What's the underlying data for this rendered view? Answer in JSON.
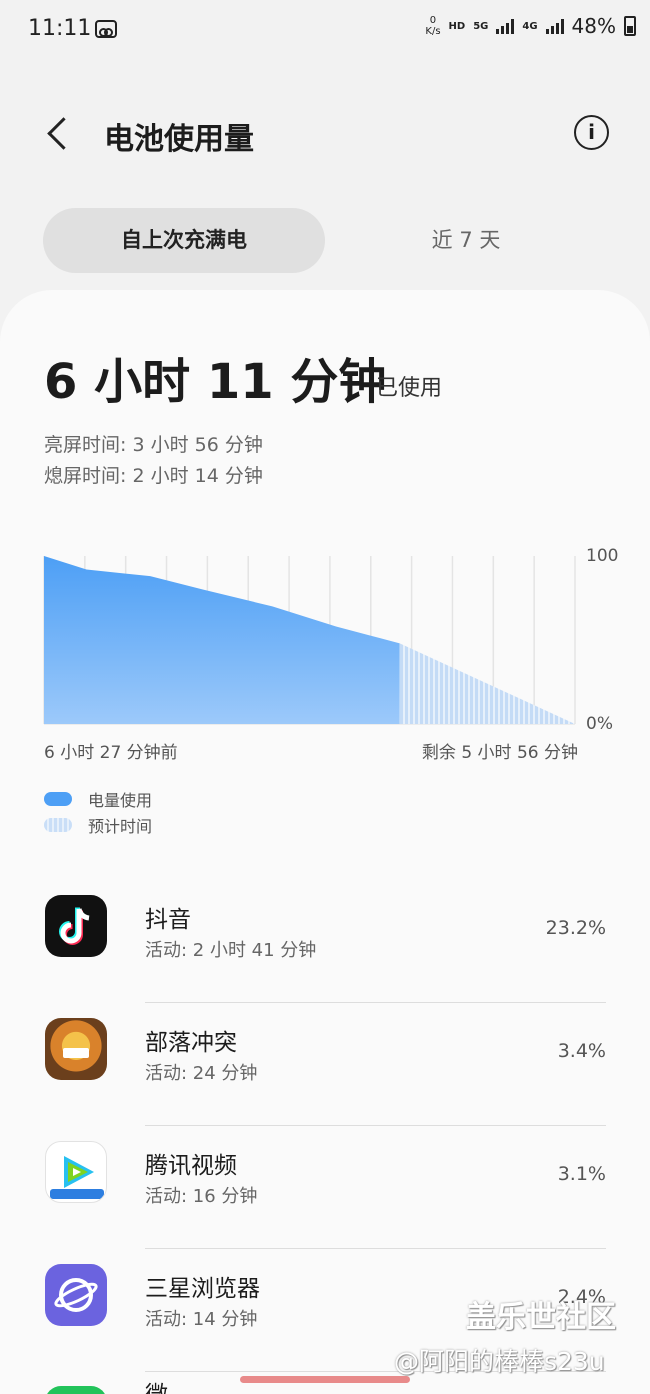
{
  "status_bar": {
    "time": "11:11",
    "net_speed_value": "0",
    "net_speed_unit": "K/s",
    "hd": "HD",
    "net1": "5G",
    "net2": "4G",
    "battery": "48%"
  },
  "header": {
    "title": "电池使用量",
    "info_symbol": "i"
  },
  "tabs": [
    {
      "label": "自上次充满电",
      "active": true
    },
    {
      "label": "近 7 天",
      "active": false
    }
  ],
  "summary": {
    "total": "6 小时 11 分钟",
    "total_suffix": "已使用",
    "screen_on": "亮屏时间: 3 小时 56 分钟",
    "screen_off": "熄屏时间:  2 小时 14 分钟"
  },
  "chart_data": {
    "type": "area",
    "ylim": [
      0,
      100
    ],
    "y_tick_labels": [
      "100",
      "0%"
    ],
    "x_start_label": "6 小时 27 分钟前",
    "x_end_label": "剩余 5 小时 56 分钟",
    "series": [
      {
        "name": "电量使用",
        "x": [
          0,
          0.08,
          0.2,
          0.3,
          0.43,
          0.55,
          0.67
        ],
        "values": [
          100,
          92,
          88,
          80,
          70,
          58,
          48
        ]
      },
      {
        "name": "预计时间",
        "x": [
          0.67,
          1.0
        ],
        "values": [
          48,
          0
        ]
      }
    ],
    "legend": [
      "电量使用",
      "预计时间"
    ],
    "grid": true,
    "colors": {
      "used": "#4d9ff5",
      "projected": "#c9def7"
    }
  },
  "apps": [
    {
      "name": "抖音",
      "active": "活动: 2 小时 41 分钟",
      "percent": "23.2%",
      "icon": "tiktok-icon"
    },
    {
      "name": "部落冲突",
      "active": "活动: 24 分钟",
      "percent": "3.4%",
      "icon": "clash-of-clans-icon"
    },
    {
      "name": "腾讯视频",
      "active": "活动: 16 分钟",
      "percent": "3.1%",
      "icon": "tencent-video-icon"
    },
    {
      "name": "三星浏览器",
      "active": "活动: 14 分钟",
      "percent": "2.4%",
      "icon": "samsung-internet-icon"
    },
    {
      "name": "微信",
      "icon": "wechat-icon"
    }
  ],
  "watermark": {
    "line1": "盖乐世社区",
    "line2": "@阿阳的棒棒s23u"
  }
}
